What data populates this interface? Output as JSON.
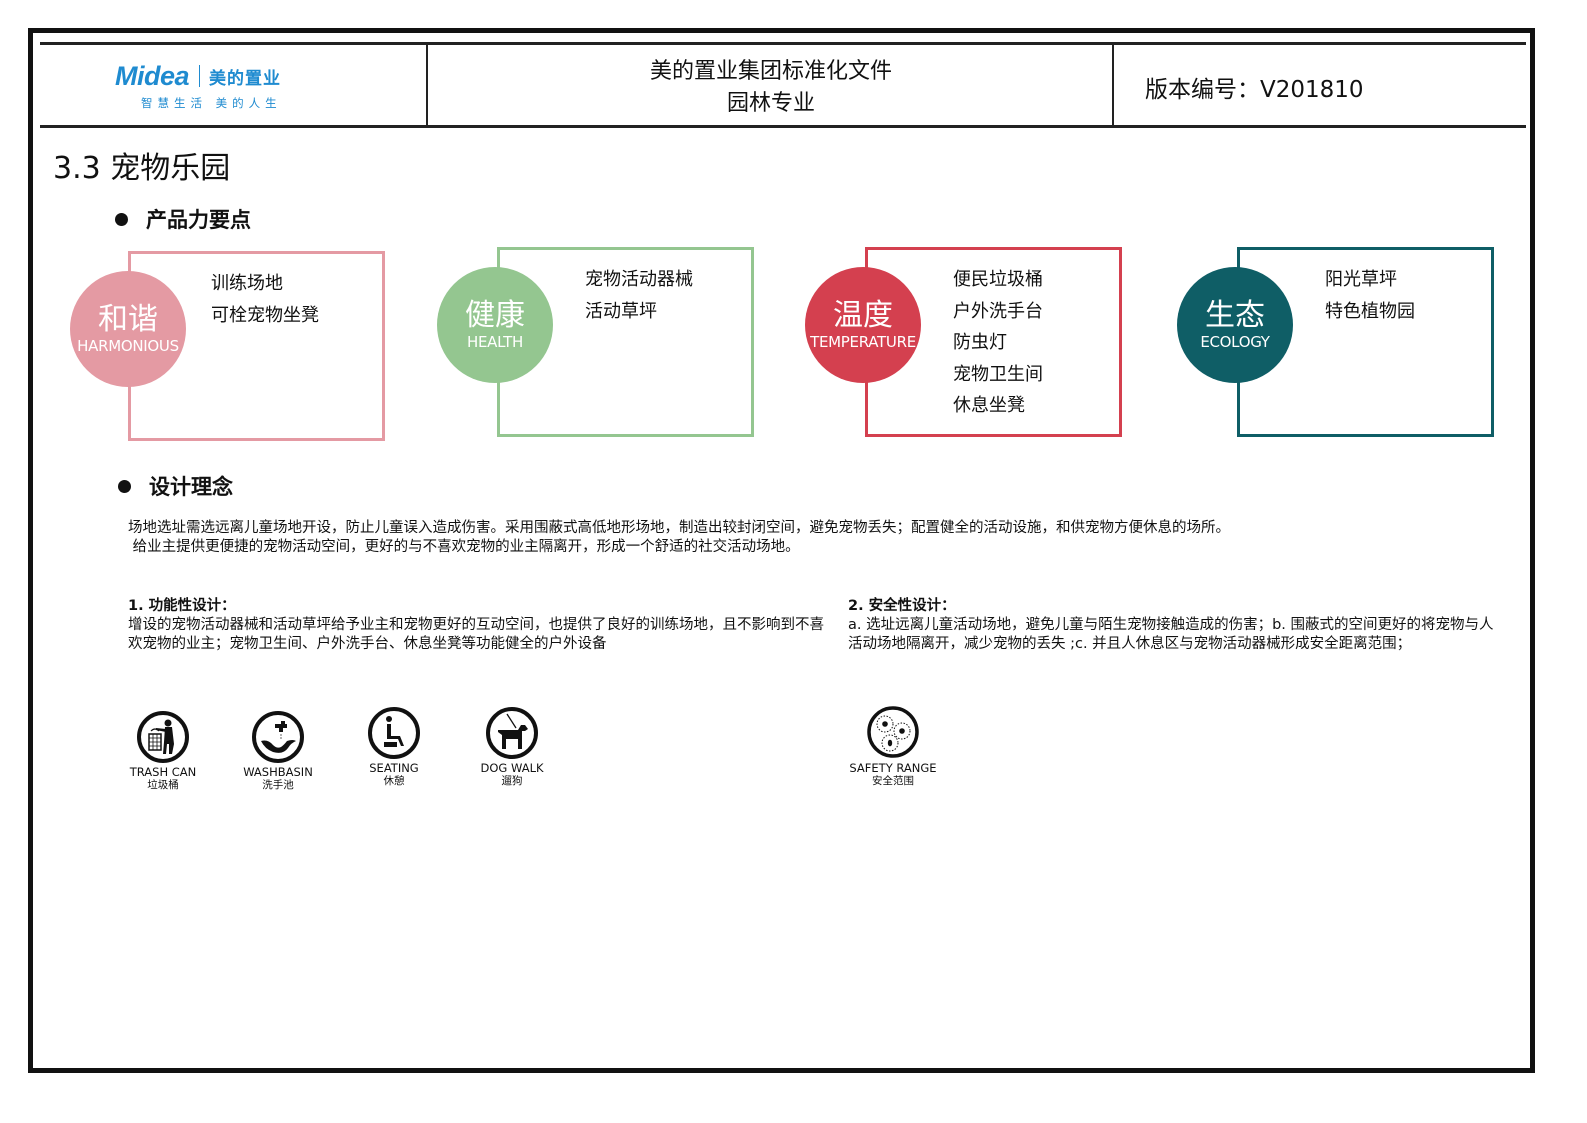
{
  "header": {
    "logo": {
      "brand": "Midea",
      "brand_cn": "美的置业",
      "slogan": "智慧生活  美的人生"
    },
    "title_line1": "美的置业集团标准化文件",
    "title_line2": "园林专业",
    "version": "版本编号：V201810"
  },
  "section_title": "3.3 宠物乐园",
  "product_points": {
    "heading": "产品力要点",
    "cards": [
      {
        "cn": "和谐",
        "en": "HARMONIOUS",
        "color": "#e49aa3",
        "items": [
          "训练场地",
          "可栓宠物坐凳"
        ]
      },
      {
        "cn": "健康",
        "en": "HEALTH",
        "color": "#94c690",
        "items": [
          "宠物活动器械",
          "活动草坪"
        ]
      },
      {
        "cn": "温度",
        "en": "TEMPERATURE",
        "color": "#d4404f",
        "items": [
          "便民垃圾桶",
          "户外洗手台",
          "防虫灯",
          "宠物卫生间",
          "休息坐凳"
        ]
      },
      {
        "cn": "生态",
        "en": "ECOLOGY",
        "color": "#0f5e66",
        "items": [
          "阳光草坪",
          "特色植物园"
        ]
      }
    ]
  },
  "design_concept": {
    "heading": "设计理念",
    "intro_line1": "场地选址需选远离儿童场地开设，防止儿童误入造成伤害。采用围蔽式高低地形场地，制造出较封闭空间，避免宠物丢失；配置健全的活动设施，和供宠物方便休息的场所。",
    "intro_line2": " 给业主提供更便捷的宠物活动空间，更好的与不喜欢宠物的业主隔离开，形成一个舒适的社交活动场地。",
    "functional": {
      "title": "1. 功能性设计：",
      "body": "增设的宠物活动器械和活动草坪给予业主和宠物更好的互动空间，也提供了良好的训练场地，且不影响到不喜欢宠物的业主；宠物卫生间、户外洗手台、休息坐凳等功能健全的户外设备"
    },
    "safety": {
      "title": "2. 安全性设计：",
      "body": "a. 选址远离儿童活动场地，避免儿童与陌生宠物接触造成的伤害；b. 围蔽式的空间更好的将宠物与人活动场地隔离开，减少宠物的丢失 ;c. 并且人休息区与宠物活动器械形成安全距离范围；"
    }
  },
  "signs": [
    {
      "icon": "trash-can-icon",
      "en": "TRASH CAN",
      "cn": "垃圾桶"
    },
    {
      "icon": "washbasin-icon",
      "en": "WASHBASIN",
      "cn": "洗手池"
    },
    {
      "icon": "seating-icon",
      "en": "SEATING",
      "cn": "休憩"
    },
    {
      "icon": "dog-walk-icon",
      "en": "DOG WALK",
      "cn": "遛狗"
    },
    {
      "icon": "safety-range-icon",
      "en": "SAFETY RANGE",
      "cn": "安全范围"
    }
  ]
}
